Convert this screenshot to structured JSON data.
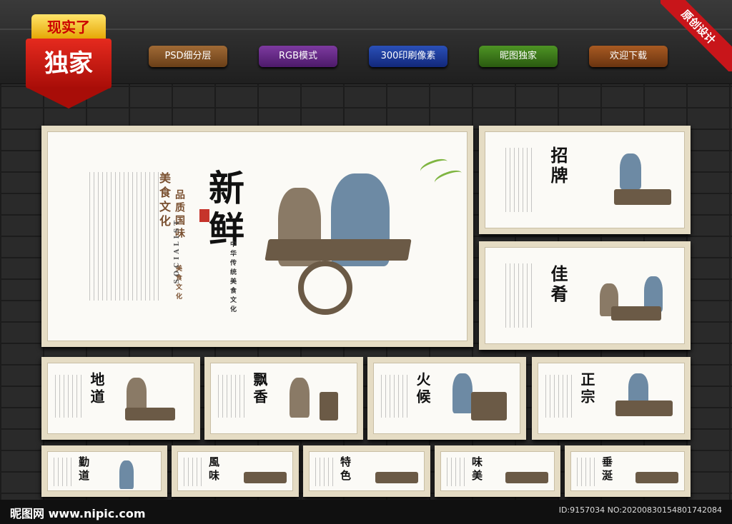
{
  "badge": {
    "top": "现实了",
    "main": "独家"
  },
  "pills": [
    {
      "label": "PSD细分层",
      "color": "#8a5a2a"
    },
    {
      "label": "RGB模式",
      "color": "#6a2a8a"
    },
    {
      "label": "300印刷像素",
      "color": "#1a3a9a"
    },
    {
      "label": "昵图独家",
      "color": "#3a7a1a"
    },
    {
      "label": "欢迎下载",
      "color": "#8a4a1a"
    }
  ],
  "corner": "原创设计",
  "main_poster": {
    "title": "新鲜",
    "side_caption": "美食文化",
    "side_caption2": "品质国味",
    "side_small": "美食文化",
    "socialist": "SOCIALIST",
    "tagline": "中华传统美食文化"
  },
  "right_posters": [
    {
      "title": "招牌"
    },
    {
      "title": "佳肴"
    }
  ],
  "middle_posters": [
    {
      "title": "地道"
    },
    {
      "title": "飘香"
    },
    {
      "title": "火候"
    },
    {
      "title": "正宗"
    }
  ],
  "bottom_posters": [
    {
      "title": "勤道"
    },
    {
      "title": "風味"
    },
    {
      "title": "特色"
    },
    {
      "title": "味美"
    },
    {
      "title": "垂涎"
    }
  ],
  "footer": {
    "logo": "昵图网 www.nipic.com",
    "id": "ID:9157034 NO:20200830154801742084"
  }
}
